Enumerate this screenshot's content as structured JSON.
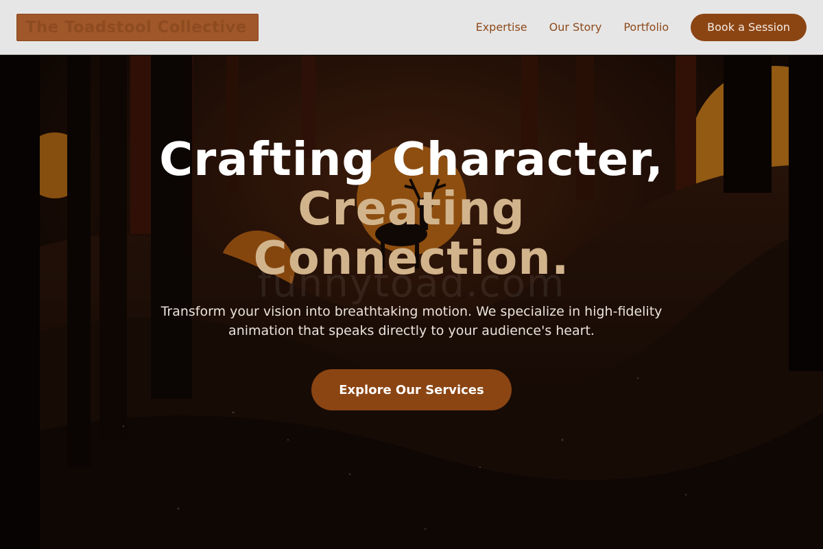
{
  "header": {
    "logo_text": "The Toadstool Collective",
    "nav": [
      {
        "label": "Expertise"
      },
      {
        "label": "Our Story"
      },
      {
        "label": "Portfolio"
      }
    ],
    "cta_label": "Book a Session"
  },
  "hero": {
    "headline_line1": "Crafting Character,",
    "headline_line2": "Creating",
    "headline_line3": "Connection.",
    "watermark": "funnytoad.com",
    "subtext": "Transform your vision into breathtaking motion. We specialize in high-fidelity animation that speaks directly to your audience's heart.",
    "cta_label": "Explore Our Services",
    "background_image": "forest-sunset-deer-image"
  },
  "colors": {
    "brand_brown": "#8b4513",
    "accent_tan": "#d2b48c",
    "header_bg": "#e7e6e6",
    "sun_orange": "#e08a1e"
  }
}
